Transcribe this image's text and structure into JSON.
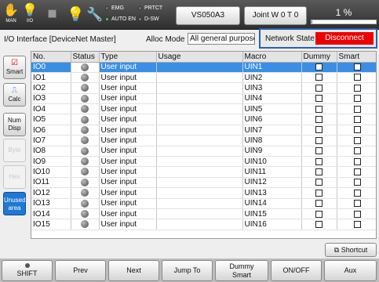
{
  "topbar": {
    "man_label": "MAN",
    "io_label": "I/O",
    "leds": [
      {
        "label": "EMG",
        "on": false
      },
      {
        "label": "PRTCT",
        "on": false
      },
      {
        "label": "AUTO EN",
        "on": true
      },
      {
        "label": "D-SW",
        "on": false
      }
    ],
    "robot_button": "VS050A3",
    "coord_button": "Joint W 0 T 0",
    "speed_text": "1 %",
    "speed_fraction": 0.01
  },
  "header": {
    "title": "I/O Interface [DeviceNet Master]",
    "alloc_label": "Alloc Mode",
    "alloc_value": "All general purpose",
    "network_label": "Network State",
    "network_value": "Disconnect"
  },
  "sidebar": {
    "smart": "Smart",
    "calc": "Calc",
    "num_disp_1": "Num",
    "num_disp_2": "Disp",
    "byte": "Byte",
    "hex": "Hex",
    "unused_1": "Unused",
    "unused_2": "area"
  },
  "table": {
    "columns": [
      "No.",
      "Status",
      "Type",
      "Usage",
      "Macro",
      "Dummy",
      "Smart"
    ],
    "rows": [
      {
        "no": "IO0",
        "type": "User input",
        "usage": "",
        "macro": "UIN1"
      },
      {
        "no": "IO1",
        "type": "User input",
        "usage": "",
        "macro": "UIN2"
      },
      {
        "no": "IO2",
        "type": "User input",
        "usage": "",
        "macro": "UIN3"
      },
      {
        "no": "IO3",
        "type": "User input",
        "usage": "",
        "macro": "UIN4"
      },
      {
        "no": "IO4",
        "type": "User input",
        "usage": "",
        "macro": "UIN5"
      },
      {
        "no": "IO5",
        "type": "User input",
        "usage": "",
        "macro": "UIN6"
      },
      {
        "no": "IO6",
        "type": "User input",
        "usage": "",
        "macro": "UIN7"
      },
      {
        "no": "IO7",
        "type": "User input",
        "usage": "",
        "macro": "UIN8"
      },
      {
        "no": "IO8",
        "type": "User input",
        "usage": "",
        "macro": "UIN9"
      },
      {
        "no": "IO9",
        "type": "User input",
        "usage": "",
        "macro": "UIN10"
      },
      {
        "no": "IO10",
        "type": "User input",
        "usage": "",
        "macro": "UIN11"
      },
      {
        "no": "IO11",
        "type": "User input",
        "usage": "",
        "macro": "UIN12"
      },
      {
        "no": "IO12",
        "type": "User input",
        "usage": "",
        "macro": "UIN13"
      },
      {
        "no": "IO13",
        "type": "User input",
        "usage": "",
        "macro": "UIN14"
      },
      {
        "no": "IO14",
        "type": "User input",
        "usage": "",
        "macro": "UIN15"
      },
      {
        "no": "IO15",
        "type": "User input",
        "usage": "",
        "macro": "UIN16"
      }
    ]
  },
  "shortcut_label": "Shortcut",
  "footer": {
    "shift": "SHIFT",
    "prev": "Prev",
    "next": "Next",
    "jump_to": "Jump To",
    "dummy_smart_1": "Dummy",
    "dummy_smart_2": "Smart",
    "on_off": "ON/OFF",
    "aux": "Aux"
  },
  "colors": {
    "selection": "#3a8ee6",
    "network_error": "#ee0000",
    "network_border": "#2a5fb2",
    "unused_area": "#1f78d1"
  }
}
